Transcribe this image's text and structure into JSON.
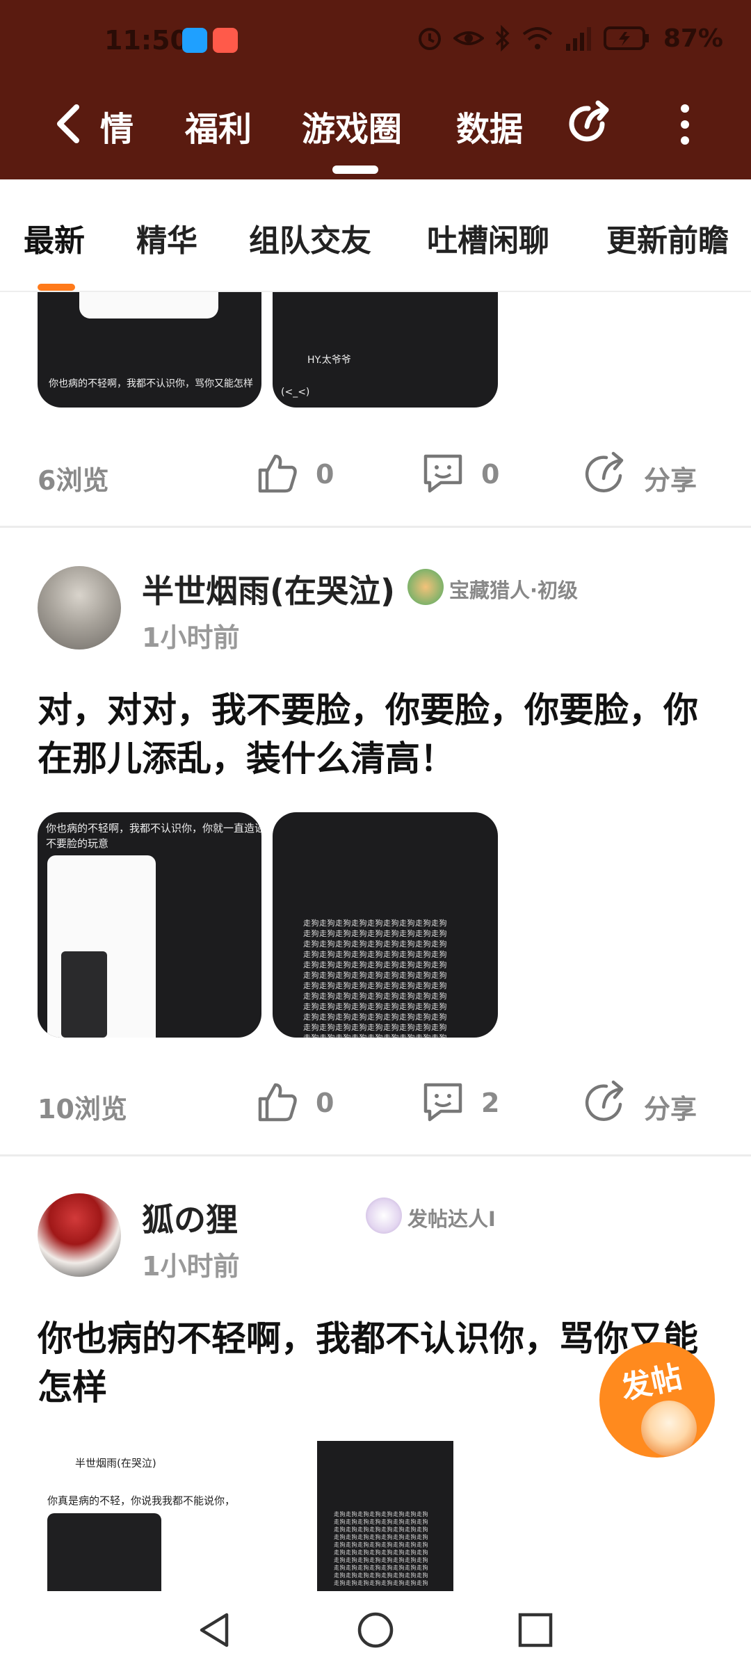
{
  "status_bar": {
    "time": "11:50",
    "battery": "87%"
  },
  "header": {
    "tabs": [
      {
        "label": "情"
      },
      {
        "label": "福利"
      },
      {
        "label": "游戏圈"
      },
      {
        "label": "数据"
      }
    ],
    "active_tab": "游戏圈"
  },
  "sub_tabs": [
    {
      "label": "最新"
    },
    {
      "label": "精华"
    },
    {
      "label": "组队交友"
    },
    {
      "label": "吐槽闲聊"
    },
    {
      "label": "更新前瞻"
    }
  ],
  "posts": [
    {
      "thumb_texts": [
        "你也病的不轻啊，我都不认识你，骂你又能怎样",
        "HY.太爷爷",
        "(<_<)"
      ],
      "views": "6浏览",
      "likes": "0",
      "comments": "0",
      "share_label": "分享"
    },
    {
      "author": "半世烟雨(在哭泣)",
      "badge": "宝藏猎人·初级",
      "time": "1小时前",
      "title": "对，对对，我不要脸，你要脸，你要脸，你在那儿添乱，装什么清高！",
      "thumb_texts": [
        "你也病的不轻啊，我都不认识你，你就一直造谣，",
        "不要脸的玩意"
      ],
      "views": "10浏览",
      "likes": "0",
      "comments": "2",
      "share_label": "分享"
    },
    {
      "author": "狐の狸",
      "badge": "发帖达人I",
      "time": "1小时前",
      "title": "你也病的不轻啊，我都不认识你，骂你又能怎样",
      "thumb_texts": [
        "半世烟雨(在哭泣)",
        "你真是病的不轻，你说我我都不能说你，"
      ]
    }
  ],
  "fab": {
    "label": "发帖"
  },
  "colors": {
    "header_bg": "#5a1b10",
    "accent": "#ff7a1a",
    "fab": "#ff8a1e"
  },
  "icons": [
    "back-icon",
    "share-icon",
    "more-icon",
    "like-icon",
    "comment-icon",
    "share-arrow-icon",
    "nav-back-icon",
    "nav-home-icon",
    "nav-recent-icon"
  ]
}
